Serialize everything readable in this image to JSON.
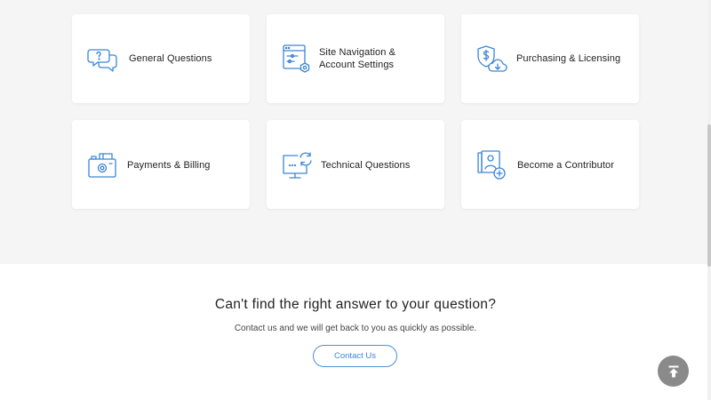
{
  "categories": [
    {
      "label_line1": "General Questions",
      "label_line2": "",
      "icon": "chat-bubbles-question-icon"
    },
    {
      "label_line1": "Site Navigation &",
      "label_line2": "Account Settings",
      "icon": "browser-settings-icon"
    },
    {
      "label_line1": "Purchasing & Licensing",
      "label_line2": "",
      "icon": "shield-dollar-download-icon"
    },
    {
      "label_line1": "Payments & Billing",
      "label_line2": "",
      "icon": "wallet-camera-icon"
    },
    {
      "label_line1": "Technical Questions",
      "label_line2": "",
      "icon": "monitor-refresh-icon"
    },
    {
      "label_line1": "Become a Contributor",
      "label_line2": "",
      "icon": "photos-add-icon"
    }
  ],
  "cta": {
    "title": "Can't find the right answer to your question?",
    "subtitle": "Contact us and we will get back to you as quickly as possible.",
    "button_label": "Contact Us"
  },
  "colors": {
    "accent": "#3b86d6",
    "grey_bg": "#f5f5f5",
    "top_button": "#8a8a8a"
  }
}
